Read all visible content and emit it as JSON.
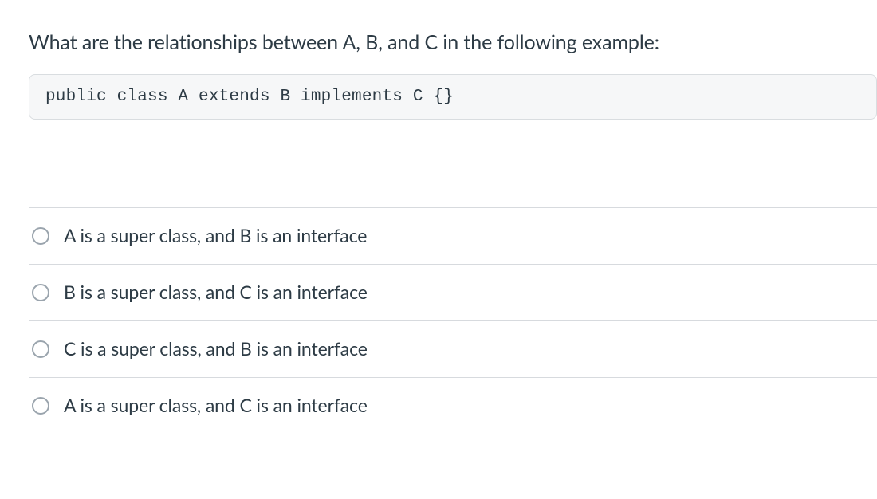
{
  "question": {
    "prompt": "What are the relationships between A, B, and C in the following example:",
    "code": "public class A extends B implements C {}"
  },
  "options": [
    {
      "label": "A is a super class, and B is an interface"
    },
    {
      "label": "B is a super class, and C is an interface"
    },
    {
      "label": "C is a super class, and B is an interface"
    },
    {
      "label": "A is a super class, and C is an interface"
    }
  ]
}
